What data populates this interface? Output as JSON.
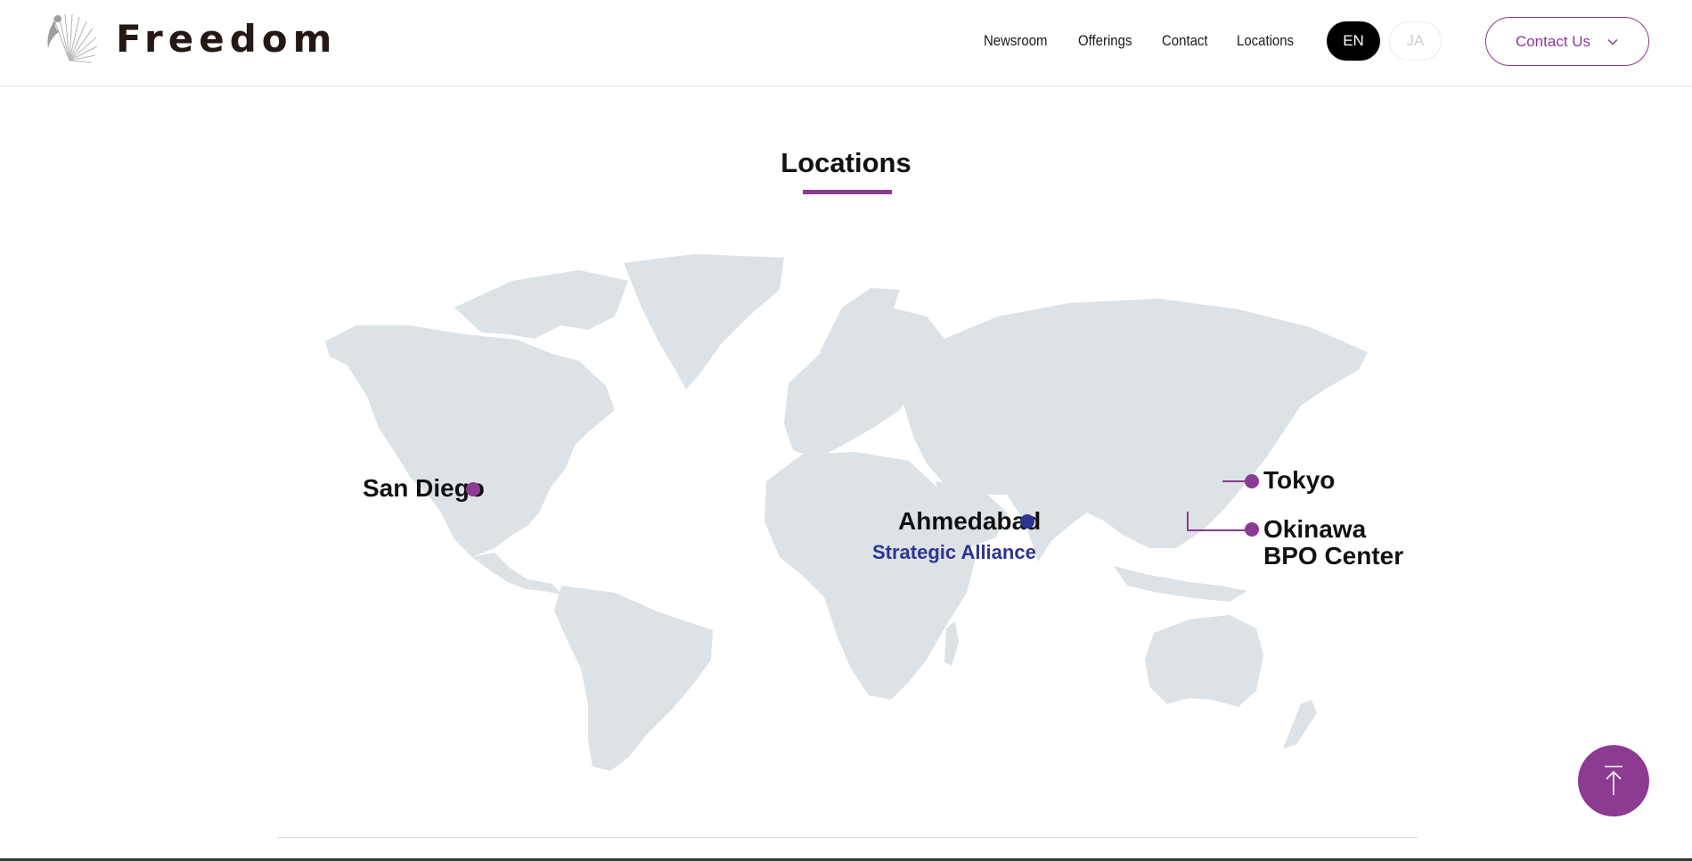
{
  "header": {
    "brand": "Freedom",
    "nav": [
      "Newsroom",
      "Offerings",
      "Contact",
      "Locations"
    ],
    "lang_active": "EN",
    "lang_inactive": "JA",
    "contact_button": "Contact Us"
  },
  "locations": {
    "title": "Locations",
    "san_diego": "San Diego",
    "ahmedabad": "Ahmedabad",
    "ahmedabad_note": "Strategic Alliance",
    "tokyo": "Tokyo",
    "okinawa_line1": "Okinawa",
    "okinawa_line2": "BPO Center"
  },
  "colors": {
    "accent": "#8c3a92",
    "partner": "#2e3591",
    "land": "#dce2e6"
  },
  "icons": {
    "logo": "feather-bird-logo",
    "contact_chevron": "chevron-down-icon",
    "scroll_top": "arrow-up-icon"
  }
}
